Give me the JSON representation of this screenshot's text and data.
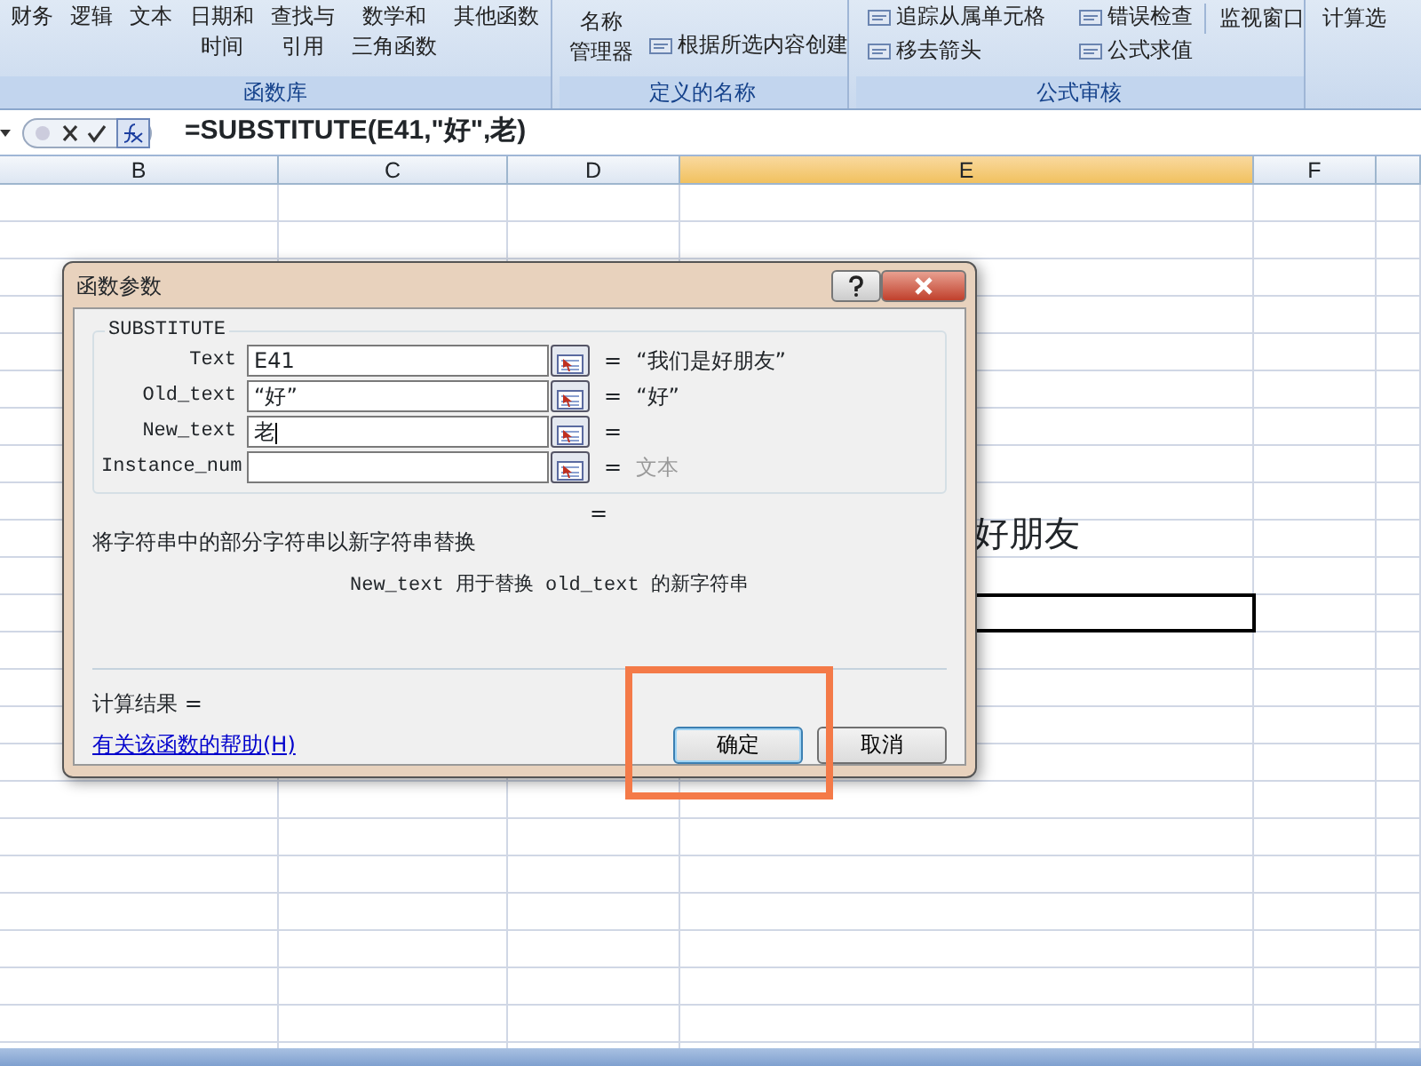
{
  "ribbon": {
    "groups": [
      {
        "label": "函数库",
        "kind": "buttons",
        "items": [
          {
            "lines": [
              "财务"
            ]
          },
          {
            "lines": [
              "逻辑"
            ]
          },
          {
            "lines": [
              "文本"
            ]
          },
          {
            "lines": [
              "日期和",
              "时间"
            ]
          },
          {
            "lines": [
              "查找与",
              "引用"
            ]
          },
          {
            "lines": [
              "数学和",
              "三角函数"
            ]
          },
          {
            "lines": [
              "其他函数"
            ]
          }
        ]
      },
      {
        "label": "定义的名称",
        "kind": "names",
        "big": [
          "名称",
          "管理器"
        ],
        "small": [
          "根据所选内容创建"
        ]
      },
      {
        "label": "公式审核",
        "kind": "audit",
        "small": [
          "追踪从属单元格",
          "错误检查",
          "移去箭头",
          "公式求值"
        ],
        "big": "监视窗口"
      },
      {
        "kind": "partial",
        "big": "计算选"
      }
    ]
  },
  "formula_bar": {
    "formula": "=SUBSTITUTE(E41,\"好\",老)"
  },
  "sheet": {
    "columns": [
      {
        "label": "B",
        "selected": false
      },
      {
        "label": "C",
        "selected": false
      },
      {
        "label": "D",
        "selected": false
      },
      {
        "label": "E",
        "selected": true
      },
      {
        "label": "F",
        "selected": false
      }
    ],
    "cells": [
      {
        "kind": "text",
        "text": "好朋友"
      },
      {
        "kind": "active"
      }
    ]
  },
  "dialog": {
    "title": "函数参数",
    "function": "SUBSTITUTE",
    "args": [
      {
        "label": "Text",
        "value": "E41",
        "result": "“我们是好朋友”",
        "kind": "value"
      },
      {
        "label": "Old_text",
        "value": "“好”",
        "result": "“好”",
        "kind": "value"
      },
      {
        "label": "New_text",
        "value": "老",
        "kind": "empty"
      },
      {
        "label": "Instance_num",
        "result": "文本",
        "kind": "hint"
      }
    ],
    "equals": "=",
    "description": "将字符串中的部分字符串以新字符串替换",
    "arg_help": "New_text 用于替换 old_text 的新字符串",
    "result_label": "计算结果 =",
    "help_link": "有关该函数的帮助(H)",
    "buttons": [
      {
        "label": "确定",
        "selected": true
      },
      {
        "label": "取消",
        "selected": false
      }
    ]
  }
}
